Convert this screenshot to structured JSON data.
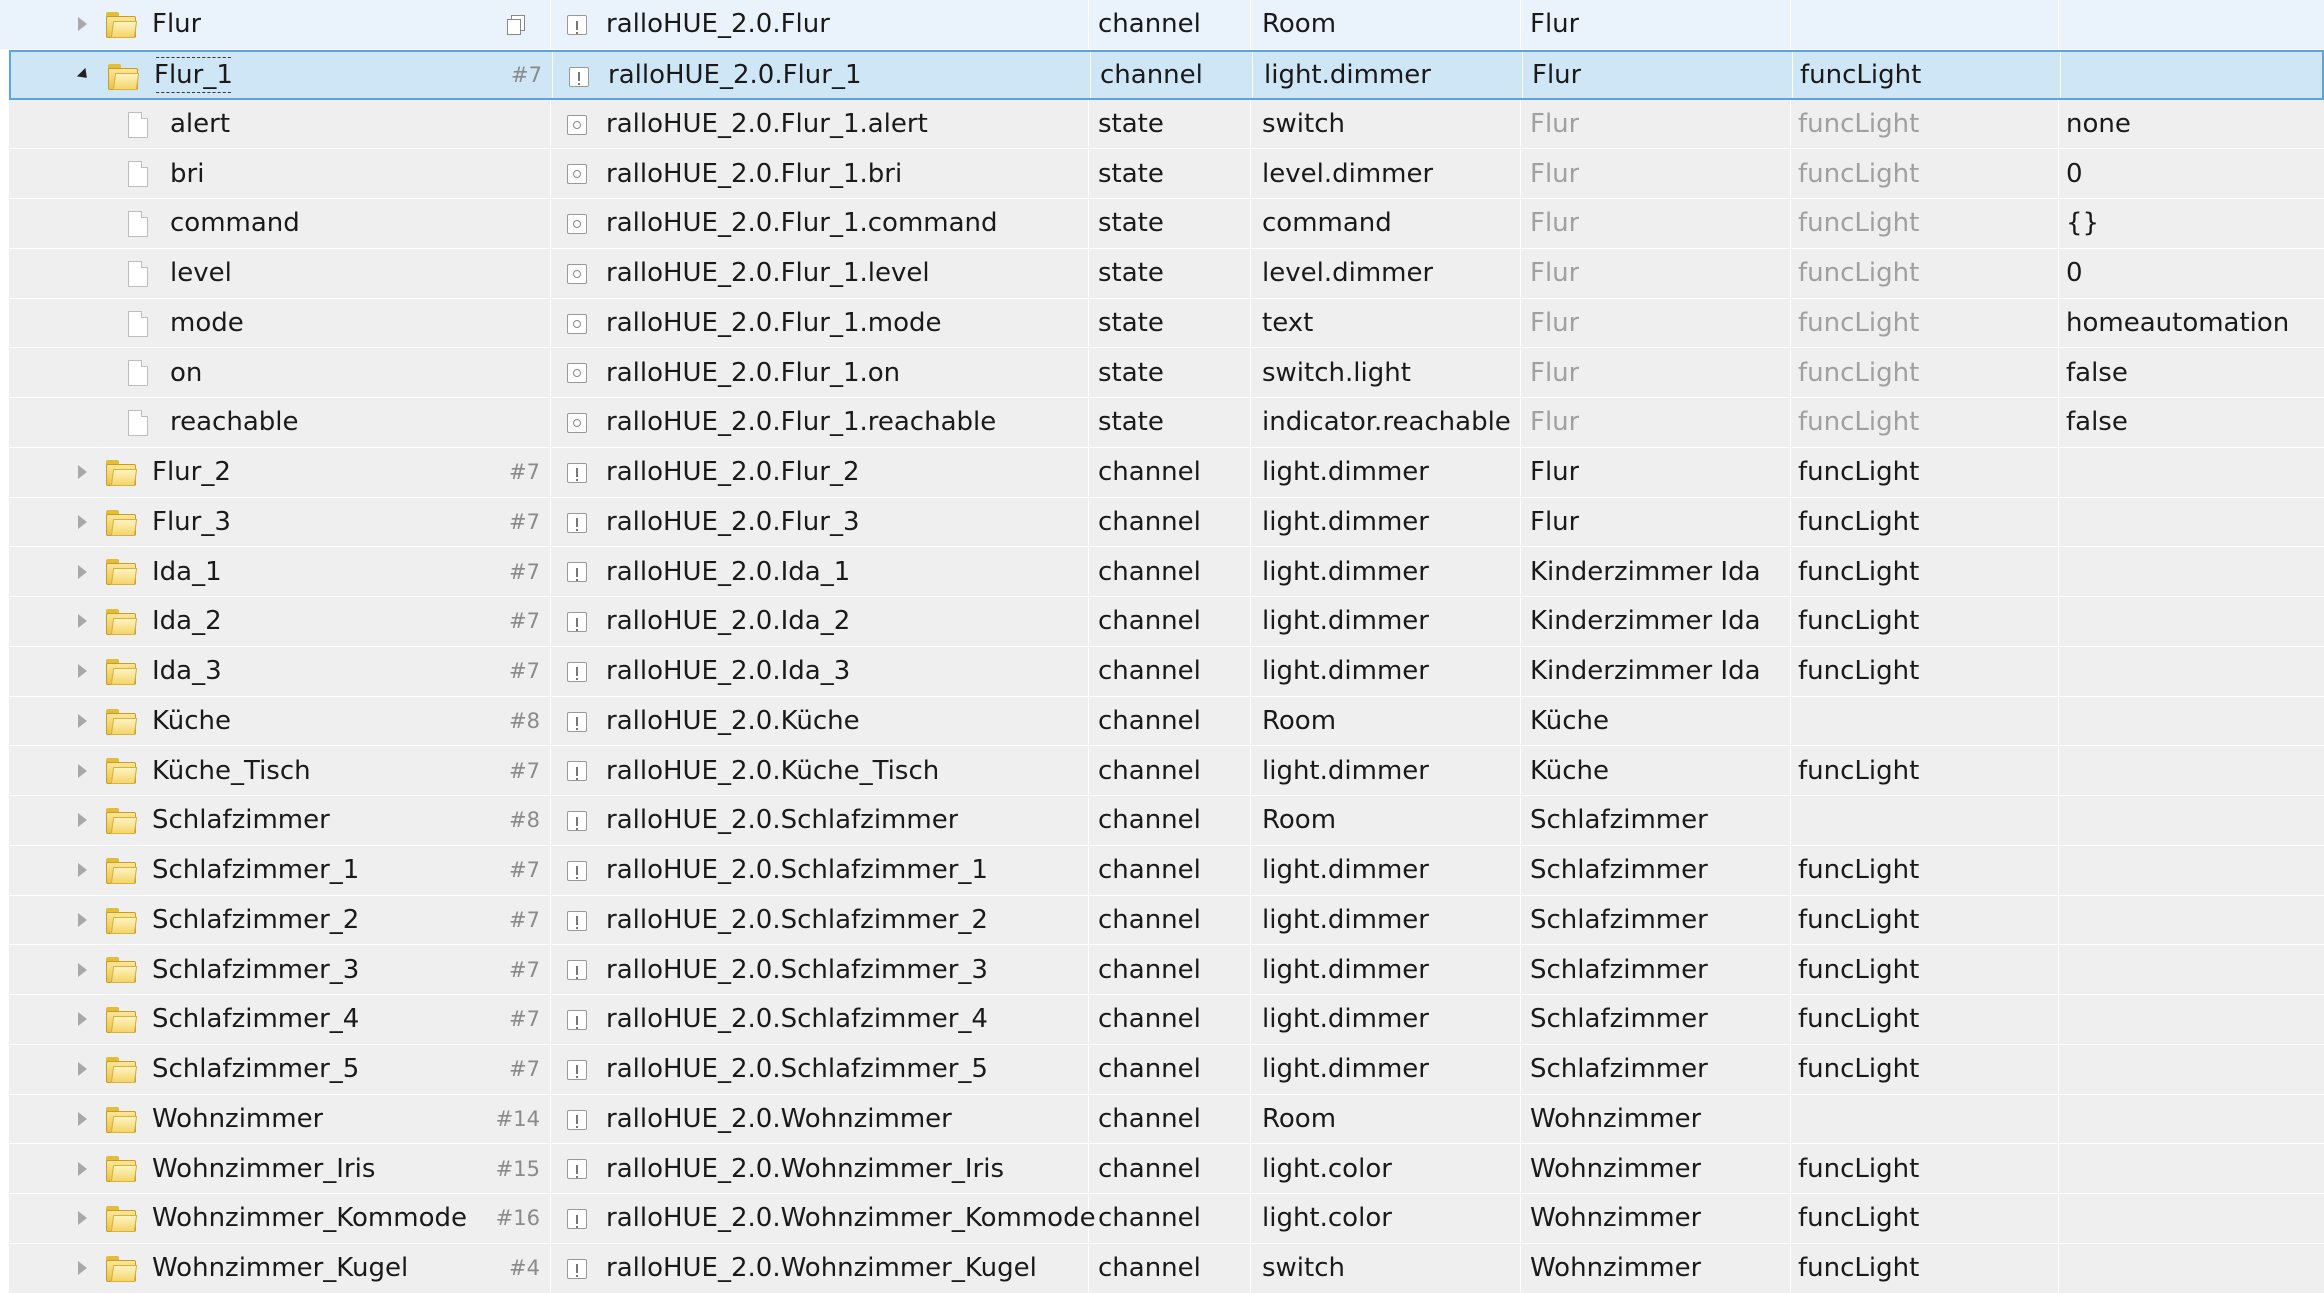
{
  "rows": [
    {
      "toggle": "collapsed",
      "icon": "folder",
      "name": "Flur",
      "count": "",
      "copy": true,
      "type_icon": "channel",
      "id": "ralloHUE_2.0.Flur",
      "type": "channel",
      "role": "Room",
      "room": "Flur",
      "function": "",
      "value": "",
      "first": true
    },
    {
      "toggle": "expanded",
      "icon": "folder",
      "name": "Flur_1",
      "count": "#7",
      "id": "ralloHUE_2.0.Flur_1",
      "type": "channel",
      "role": "light.dimmer",
      "room": "Flur",
      "function": "funcLight",
      "value": "",
      "selected": true
    },
    {
      "toggle": "none",
      "icon": "file",
      "name": "alert",
      "count": "",
      "id": "ralloHUE_2.0.Flur_1.alert",
      "type": "state",
      "role": "switch",
      "room": "Flur",
      "function": "funcLight",
      "value": "none",
      "muted": true
    },
    {
      "toggle": "none",
      "icon": "file",
      "name": "bri",
      "count": "",
      "id": "ralloHUE_2.0.Flur_1.bri",
      "type": "state",
      "role": "level.dimmer",
      "room": "Flur",
      "function": "funcLight",
      "value": "0",
      "muted": true
    },
    {
      "toggle": "none",
      "icon": "file",
      "name": "command",
      "count": "",
      "id": "ralloHUE_2.0.Flur_1.command",
      "type": "state",
      "role": "command",
      "room": "Flur",
      "function": "funcLight",
      "value": "{}",
      "muted": true
    },
    {
      "toggle": "none",
      "icon": "file",
      "name": "level",
      "count": "",
      "id": "ralloHUE_2.0.Flur_1.level",
      "type": "state",
      "role": "level.dimmer",
      "room": "Flur",
      "function": "funcLight",
      "value": "0",
      "muted": true
    },
    {
      "toggle": "none",
      "icon": "file",
      "name": "mode",
      "count": "",
      "id": "ralloHUE_2.0.Flur_1.mode",
      "type": "state",
      "role": "text",
      "room": "Flur",
      "function": "funcLight",
      "value": "homeautomation",
      "muted": true
    },
    {
      "toggle": "none",
      "icon": "file",
      "name": "on",
      "count": "",
      "id": "ralloHUE_2.0.Flur_1.on",
      "type": "state",
      "role": "switch.light",
      "room": "Flur",
      "function": "funcLight",
      "value": "false",
      "muted": true
    },
    {
      "toggle": "none",
      "icon": "file",
      "name": "reachable",
      "count": "",
      "id": "ralloHUE_2.0.Flur_1.reachable",
      "type": "state",
      "role": "indicator.reachable",
      "room": "Flur",
      "function": "funcLight",
      "value": "false",
      "muted": true
    },
    {
      "toggle": "collapsed",
      "icon": "folder",
      "name": "Flur_2",
      "count": "#7",
      "id": "ralloHUE_2.0.Flur_2",
      "type": "channel",
      "role": "light.dimmer",
      "room": "Flur",
      "function": "funcLight",
      "value": ""
    },
    {
      "toggle": "collapsed",
      "icon": "folder",
      "name": "Flur_3",
      "count": "#7",
      "id": "ralloHUE_2.0.Flur_3",
      "type": "channel",
      "role": "light.dimmer",
      "room": "Flur",
      "function": "funcLight",
      "value": ""
    },
    {
      "toggle": "collapsed",
      "icon": "folder",
      "name": "Ida_1",
      "count": "#7",
      "id": "ralloHUE_2.0.Ida_1",
      "type": "channel",
      "role": "light.dimmer",
      "room": "Kinderzimmer Ida",
      "function": "funcLight",
      "value": ""
    },
    {
      "toggle": "collapsed",
      "icon": "folder",
      "name": "Ida_2",
      "count": "#7",
      "id": "ralloHUE_2.0.Ida_2",
      "type": "channel",
      "role": "light.dimmer",
      "room": "Kinderzimmer Ida",
      "function": "funcLight",
      "value": ""
    },
    {
      "toggle": "collapsed",
      "icon": "folder",
      "name": "Ida_3",
      "count": "#7",
      "id": "ralloHUE_2.0.Ida_3",
      "type": "channel",
      "role": "light.dimmer",
      "room": "Kinderzimmer Ida",
      "function": "funcLight",
      "value": ""
    },
    {
      "toggle": "collapsed",
      "icon": "folder",
      "name": "Küche",
      "count": "#8",
      "id": "ralloHUE_2.0.Küche",
      "type": "channel",
      "role": "Room",
      "room": "Küche",
      "function": "",
      "value": ""
    },
    {
      "toggle": "collapsed",
      "icon": "folder",
      "name": "Küche_Tisch",
      "count": "#7",
      "id": "ralloHUE_2.0.Küche_Tisch",
      "type": "channel",
      "role": "light.dimmer",
      "room": "Küche",
      "function": "funcLight",
      "value": ""
    },
    {
      "toggle": "collapsed",
      "icon": "folder",
      "name": "Schlafzimmer",
      "count": "#8",
      "id": "ralloHUE_2.0.Schlafzimmer",
      "type": "channel",
      "role": "Room",
      "room": "Schlafzimmer",
      "function": "",
      "value": ""
    },
    {
      "toggle": "collapsed",
      "icon": "folder",
      "name": "Schlafzimmer_1",
      "count": "#7",
      "id": "ralloHUE_2.0.Schlafzimmer_1",
      "type": "channel",
      "role": "light.dimmer",
      "room": "Schlafzimmer",
      "function": "funcLight",
      "value": ""
    },
    {
      "toggle": "collapsed",
      "icon": "folder",
      "name": "Schlafzimmer_2",
      "count": "#7",
      "id": "ralloHUE_2.0.Schlafzimmer_2",
      "type": "channel",
      "role": "light.dimmer",
      "room": "Schlafzimmer",
      "function": "funcLight",
      "value": ""
    },
    {
      "toggle": "collapsed",
      "icon": "folder",
      "name": "Schlafzimmer_3",
      "count": "#7",
      "id": "ralloHUE_2.0.Schlafzimmer_3",
      "type": "channel",
      "role": "light.dimmer",
      "room": "Schlafzimmer",
      "function": "funcLight",
      "value": ""
    },
    {
      "toggle": "collapsed",
      "icon": "folder",
      "name": "Schlafzimmer_4",
      "count": "#7",
      "id": "ralloHUE_2.0.Schlafzimmer_4",
      "type": "channel",
      "role": "light.dimmer",
      "room": "Schlafzimmer",
      "function": "funcLight",
      "value": ""
    },
    {
      "toggle": "collapsed",
      "icon": "folder",
      "name": "Schlafzimmer_5",
      "count": "#7",
      "id": "ralloHUE_2.0.Schlafzimmer_5",
      "type": "channel",
      "role": "light.dimmer",
      "room": "Schlafzimmer",
      "function": "funcLight",
      "value": ""
    },
    {
      "toggle": "collapsed",
      "icon": "folder",
      "name": "Wohnzimmer",
      "count": "#14",
      "id": "ralloHUE_2.0.Wohnzimmer",
      "type": "channel",
      "role": "Room",
      "room": "Wohnzimmer",
      "function": "",
      "value": ""
    },
    {
      "toggle": "collapsed",
      "icon": "folder",
      "name": "Wohnzimmer_Iris",
      "count": "#15",
      "id": "ralloHUE_2.0.Wohnzimmer_Iris",
      "type": "channel",
      "role": "light.color",
      "room": "Wohnzimmer",
      "function": "funcLight",
      "value": ""
    },
    {
      "toggle": "collapsed",
      "icon": "folder",
      "name": "Wohnzimmer_Kommode",
      "count": "#16",
      "id": "ralloHUE_2.0.Wohnzimmer_Kommode",
      "type": "channel",
      "role": "light.color",
      "room": "Wohnzimmer",
      "function": "funcLight",
      "value": ""
    },
    {
      "toggle": "collapsed",
      "icon": "folder",
      "name": "Wohnzimmer_Kugel",
      "count": "#4",
      "id": "ralloHUE_2.0.Wohnzimmer_Kugel",
      "type": "channel",
      "role": "switch",
      "room": "Wohnzimmer",
      "function": "funcLight",
      "value": ""
    }
  ]
}
